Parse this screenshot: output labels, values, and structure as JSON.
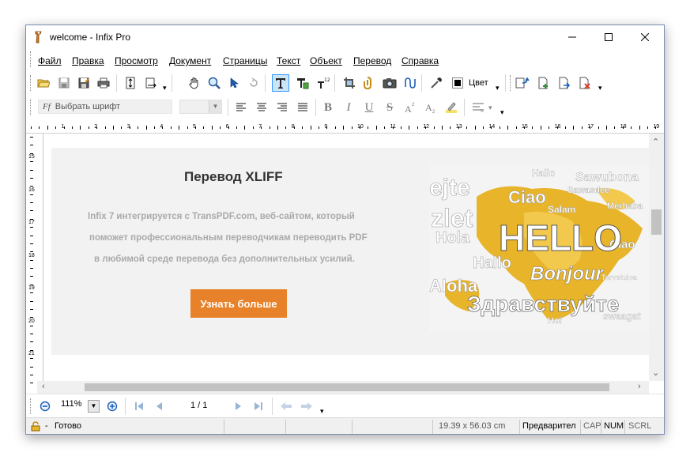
{
  "window": {
    "title": "welcome - Infix Pro",
    "controls": {
      "minimize": "—",
      "maximize": "☐",
      "close": "✕"
    }
  },
  "menu": {
    "items": [
      "Файл",
      "Правка",
      "Просмотр",
      "Документ",
      "Страницы",
      "Текст",
      "Объект",
      "Перевод",
      "Справка"
    ]
  },
  "toolbar": {
    "color_label": "Цвет"
  },
  "format_toolbar": {
    "font_placeholder": "Выбрать шрифт",
    "font_icon": "Ff"
  },
  "ruler": {
    "h_labels": [
      "1",
      "2",
      "3",
      "4",
      "5",
      "6",
      "7",
      "8",
      "9",
      "10",
      "11",
      "12",
      "13",
      "14",
      "15",
      "16",
      "17",
      "18",
      "19"
    ],
    "v_labels": [
      "15",
      "16",
      "17",
      "18",
      "19",
      "20",
      "21"
    ]
  },
  "document": {
    "heading": "Перевод XLIFF",
    "body_lines": [
      "Infix 7 интегрируется с TransPDF.com, веб-сайтом, который",
      "поможет профессиональным переводчикам переводить PDF",
      "в любимой среде перевода без дополнительных усилий."
    ],
    "cta_label": "Узнать больше",
    "image_words": {
      "hello": "HELLO",
      "bonjour": "Bonjour",
      "zdravstvuyte": "Здравствуйте",
      "ciao": "Ciao",
      "hola": "Hola",
      "hallo": "Hallo",
      "aloha": "Aloha",
      "salam": "Salam",
      "sawubona": "Sawubona",
      "ciao2": "Ciao",
      "swaagat": "swaagat",
      "zlet": "zlet",
      "ejte": "ejte",
      "hoi": "Hoi",
      "merhaba": "Merhaba",
      "sawasdee": "Sawasdee",
      "tervetuloa": "Tervetuloa"
    },
    "accent_color": "#e8822a"
  },
  "navigation": {
    "zoom": "111%",
    "page": "1 / 1"
  },
  "status": {
    "lock_label": "-",
    "state": "Готово",
    "dimensions": "19.39 x 56.03 cm",
    "mode": "Предварител",
    "caps": "CAP",
    "num": "NUM",
    "scroll": "SCRL"
  }
}
